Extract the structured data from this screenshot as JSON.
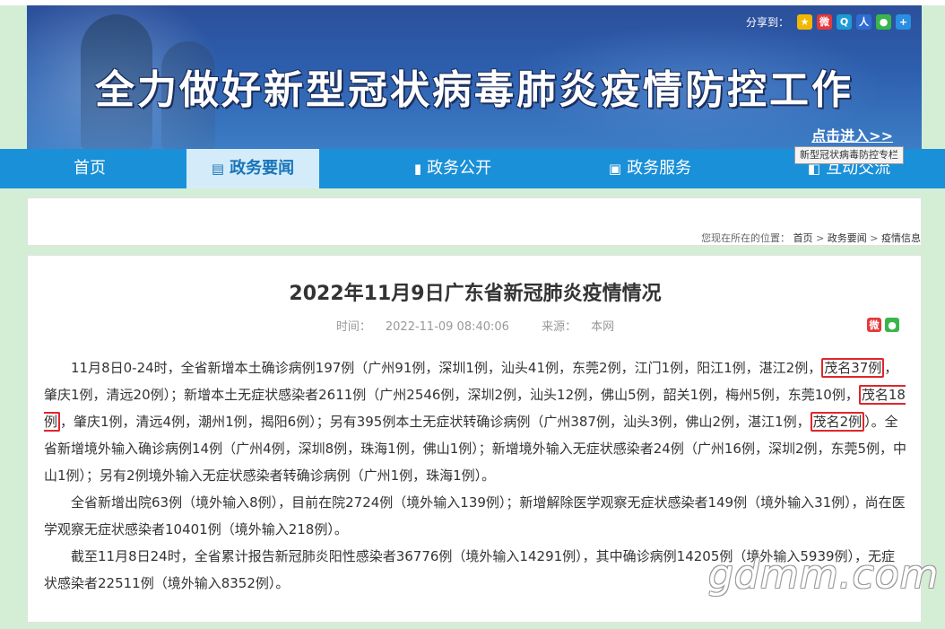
{
  "banner": {
    "share_label": "分享到：",
    "share_icons": [
      "qzone-icon",
      "weibo-icon",
      "tencent-icon",
      "renren-icon",
      "wechat-icon",
      "more-icon"
    ],
    "title": "全力做好新型冠状病毒肺炎疫情防控工作",
    "click_in": "点击进入>>",
    "tooltip": "新型冠状病毒防控专栏"
  },
  "nav": {
    "items": [
      {
        "label": "首页",
        "icon": ""
      },
      {
        "label": "政务要闻",
        "icon": "list-icon"
      },
      {
        "label": "政务公开",
        "icon": "document-icon"
      },
      {
        "label": "政务服务",
        "icon": "clipboard-icon"
      },
      {
        "label": "互动交流",
        "icon": "chat-icon"
      }
    ],
    "active_index": 1
  },
  "breadcrumb": {
    "prefix": "您现在所在的位置：",
    "items": [
      "首页",
      "政务要闻",
      "疫情信息"
    ],
    "separator": ">"
  },
  "article": {
    "title": "2022年11月9日广东省新冠肺炎疫情情况",
    "time_label": "时间：",
    "time": "2022-11-09 08:40:06",
    "source_label": "来源：",
    "source": "本网",
    "p1": {
      "a": "11月8日0-24时，全省新增本土确诊病例197例（广州91例，深圳1例，汕头41例，东莞2例，江门1例，阳江1例，湛江2例，",
      "h1": "茂名37例",
      "b": "，肇庆1例，清远20例）；新增本土无症状感染者2611例（广州2546例，深圳2例，汕头12例，佛山5例，韶关1例，梅州5例，东莞10例，",
      "h2": "茂名18例",
      "c": "，肇庆1例，清远4例，潮州1例，揭阳6例）；另有395例本土无症状转确诊病例（广州387例，汕头3例，佛山2例，湛江1例，",
      "h3": "茂名2例",
      "d": "）。全省新增境外输入确诊病例14例（广州4例，深圳8例，珠海1例，佛山1例）；新增境外输入无症状感染者24例（广州16例，深圳2例，东莞5例，中山1例）；另有2例境外输入无症状感染者转确诊病例（广州1例，珠海1例）。"
    },
    "p2": "全省新增出院63例（境外输入8例），目前在院2724例（境外输入139例）；新增解除医学观察无症状感染者149例（境外输入31例），尚在医学观察无症状感染者10401例（境外输入218例）。",
    "p3": "截至11月8日24时，全省累计报告新冠肺炎阳性感染者36776例（境外输入14291例），其中确诊病例14205例（境外输入5939例），无症状感染者22511例（境外输入8352例）。"
  },
  "watermark": "gdmm.com",
  "colors": {
    "nav_bg": "#1a90d8",
    "nav_active_bg": "#d4ecfa",
    "highlight_border": "#e0262b",
    "page_bg": "#d4eed6"
  }
}
